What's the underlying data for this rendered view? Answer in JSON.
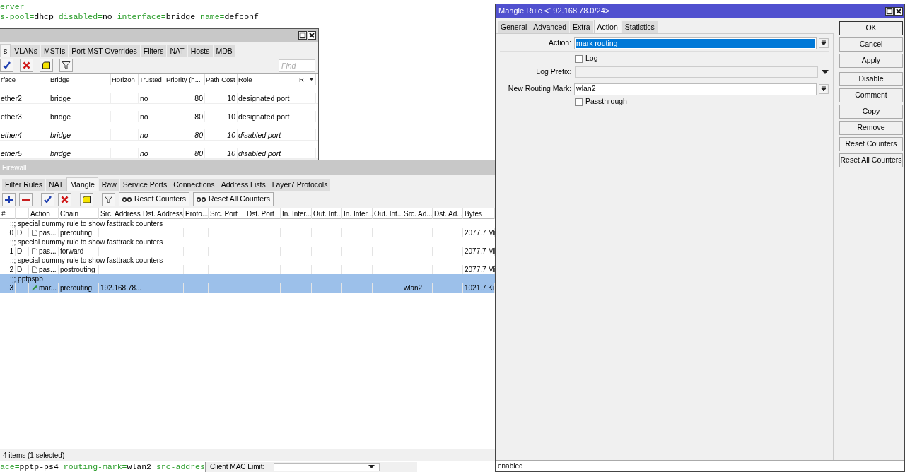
{
  "terminal": {
    "top_lines": [
      "erver",
      "s-pool=dhcp disabled=no interface=bridge name=defconf"
    ],
    "bottom_line": "ace=pptp-ps4 routing-mark=wlan2 src-addres"
  },
  "bridge_window": {
    "tabs": [
      {
        "label": "s",
        "selected": true
      },
      {
        "label": "VLANs",
        "selected": false
      },
      {
        "label": "MSTIs",
        "selected": false
      },
      {
        "label": "Port MST Overrides",
        "selected": false
      },
      {
        "label": "Filters",
        "selected": false
      },
      {
        "label": "NAT",
        "selected": false
      },
      {
        "label": "Hosts",
        "selected": false
      },
      {
        "label": "MDB",
        "selected": false
      }
    ],
    "find_placeholder": "Find",
    "columns": [
      "rface",
      "Bridge",
      "Horizon",
      "Trusted",
      "Priority (h...",
      "Path Cost",
      "Role",
      "R"
    ],
    "rows": [
      {
        "interface": "ether2",
        "bridge": "bridge",
        "trusted": "no",
        "priority": "80",
        "path_cost": "10",
        "role": "designated port",
        "disabled": false
      },
      {
        "interface": "ether3",
        "bridge": "bridge",
        "trusted": "no",
        "priority": "80",
        "path_cost": "10",
        "role": "designated port",
        "disabled": false
      },
      {
        "interface": "ether4",
        "bridge": "bridge",
        "trusted": "no",
        "priority": "80",
        "path_cost": "10",
        "role": "disabled port",
        "disabled": true
      },
      {
        "interface": "ether5",
        "bridge": "bridge",
        "trusted": "no",
        "priority": "80",
        "path_cost": "10",
        "role": "disabled port",
        "disabled": true
      }
    ]
  },
  "firewall_window": {
    "title": "Firewall",
    "tabs": [
      {
        "label": "Filter Rules",
        "selected": false
      },
      {
        "label": "NAT",
        "selected": false
      },
      {
        "label": "Mangle",
        "selected": true
      },
      {
        "label": "Raw",
        "selected": false
      },
      {
        "label": "Service Ports",
        "selected": false
      },
      {
        "label": "Connections",
        "selected": false
      },
      {
        "label": "Address Lists",
        "selected": false
      },
      {
        "label": "Layer7 Protocols",
        "selected": false
      }
    ],
    "counter_buttons": [
      "Reset Counters",
      "Reset All Counters"
    ],
    "columns": [
      "#",
      "Action",
      "Chain",
      "Src. Address",
      "Dst. Address",
      "Proto...",
      "Src. Port",
      "Dst. Port",
      "In. Inter...",
      "Out. Int...",
      "In. Inter...",
      "Out. Int...",
      "Src. Ad...",
      "Dst. Ad...",
      "Bytes"
    ],
    "rows": [
      {
        "kind": "comment",
        "text": ";;; special dummy rule to show fasttrack counters",
        "selected": false
      },
      {
        "kind": "rule",
        "number": "0",
        "flag": "D",
        "action": {
          "kind": "passthrough",
          "text": "pas..."
        },
        "chain": "prerouting",
        "bytes": "2077.7 Mi",
        "selected": false
      },
      {
        "kind": "comment",
        "text": ";;; special dummy rule to show fasttrack counters",
        "selected": false
      },
      {
        "kind": "rule",
        "number": "1",
        "flag": "D",
        "action": {
          "kind": "passthrough",
          "text": "pas..."
        },
        "chain": "forward",
        "bytes": "2077.7 Mi",
        "selected": false
      },
      {
        "kind": "comment",
        "text": ";;; special dummy rule to show fasttrack counters",
        "selected": false
      },
      {
        "kind": "rule",
        "number": "2",
        "flag": "D",
        "action": {
          "kind": "passthrough",
          "text": "pas..."
        },
        "chain": "postrouting",
        "bytes": "2077.7 Mi",
        "selected": false
      },
      {
        "kind": "comment",
        "text": ";;; pptpspb",
        "selected": true
      },
      {
        "kind": "rule",
        "number": "3",
        "action": {
          "kind": "mark",
          "text": "mar..."
        },
        "chain": "prerouting",
        "src_address": "192.168.78...",
        "column_13": "wlan2",
        "bytes": "1021.7 Ki",
        "selected": true
      }
    ],
    "status": "4 items (1 selected)"
  },
  "client_mac_limit": {
    "label": "Client MAC Limit:"
  },
  "mangle_rule_window": {
    "title": "Mangle Rule <192.168.78.0/24>",
    "tabs": [
      {
        "label": "General",
        "selected": false
      },
      {
        "label": "Advanced",
        "selected": false
      },
      {
        "label": "Extra",
        "selected": false
      },
      {
        "label": "Action",
        "selected": true
      },
      {
        "label": "Statistics",
        "selected": false
      }
    ],
    "sections": [
      [
        {
          "kind": "select",
          "label": "Action:",
          "value": "mark routing",
          "highlighted": true
        }
      ],
      [
        {
          "kind": "checkbox",
          "label": "Log",
          "checked": false
        },
        {
          "kind": "combo",
          "label": "Log Prefix:"
        }
      ],
      [
        {
          "kind": "select",
          "label": "New Routing Mark:",
          "value": "wlan2",
          "highlighted": false
        },
        {
          "kind": "checkbox",
          "label": "Passthrough",
          "checked": false
        }
      ]
    ],
    "buttons": [
      {
        "label": "OK",
        "default": true
      },
      {
        "label": "Cancel",
        "default": false
      },
      {
        "label": "Apply",
        "default": false
      },
      {
        "label": "Disable",
        "default": false
      },
      {
        "label": "Comment",
        "default": false
      },
      {
        "label": "Copy",
        "default": false
      },
      {
        "label": "Remove",
        "default": false
      },
      {
        "label": "Reset Counters",
        "default": false
      },
      {
        "label": "Reset All Counters",
        "default": false
      }
    ],
    "status": "enabled"
  }
}
